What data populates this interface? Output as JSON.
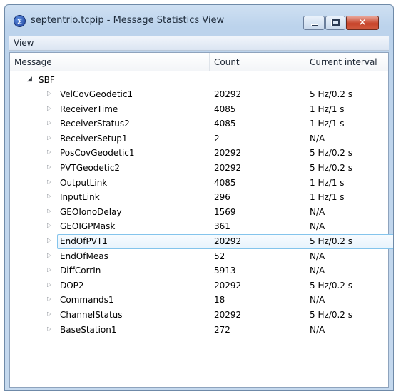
{
  "window": {
    "title": "septentrio.tcpip - Message Statistics View",
    "app_icon_glyph": "Σ",
    "close_glyph": "✕"
  },
  "menu": {
    "view_label": "View"
  },
  "table": {
    "headers": {
      "message": "Message",
      "count": "Count",
      "interval": "Current interval"
    },
    "root_label": "SBF",
    "rows": [
      {
        "name": "VelCovGeodetic1",
        "count": "20292",
        "interval": "5 Hz/0.2 s"
      },
      {
        "name": "ReceiverTime",
        "count": "4085",
        "interval": "1 Hz/1 s"
      },
      {
        "name": "ReceiverStatus2",
        "count": "4085",
        "interval": "1 Hz/1 s"
      },
      {
        "name": "ReceiverSetup1",
        "count": "2",
        "interval": "N/A"
      },
      {
        "name": "PosCovGeodetic1",
        "count": "20292",
        "interval": "5 Hz/0.2 s"
      },
      {
        "name": "PVTGeodetic2",
        "count": "20292",
        "interval": "5 Hz/0.2 s"
      },
      {
        "name": "OutputLink",
        "count": "4085",
        "interval": "1 Hz/1 s"
      },
      {
        "name": "InputLink",
        "count": "296",
        "interval": "1 Hz/1 s"
      },
      {
        "name": "GEOIonoDelay",
        "count": "1569",
        "interval": "N/A"
      },
      {
        "name": "GEOIGPMask",
        "count": "361",
        "interval": "N/A"
      },
      {
        "name": "EndOfPVT1",
        "count": "20292",
        "interval": "5 Hz/0.2 s"
      },
      {
        "name": "EndOfMeas",
        "count": "52",
        "interval": "N/A"
      },
      {
        "name": "DiffCorrIn",
        "count": "5913",
        "interval": "N/A"
      },
      {
        "name": "DOP2",
        "count": "20292",
        "interval": "5 Hz/0.2 s"
      },
      {
        "name": "Commands1",
        "count": "18",
        "interval": "N/A"
      },
      {
        "name": "ChannelStatus",
        "count": "20292",
        "interval": "5 Hz/0.2 s"
      },
      {
        "name": "BaseStation1",
        "count": "272",
        "interval": "N/A"
      }
    ],
    "selected_row": "EndOfPVT1"
  },
  "colors": {
    "title_bar": "#bcd3ec",
    "close_button": "#c7442b",
    "selection_border": "#84c4ec"
  },
  "icons": {
    "collapsed": "collapsed-triangle-icon",
    "expanded": "expanded-triangle-icon"
  }
}
